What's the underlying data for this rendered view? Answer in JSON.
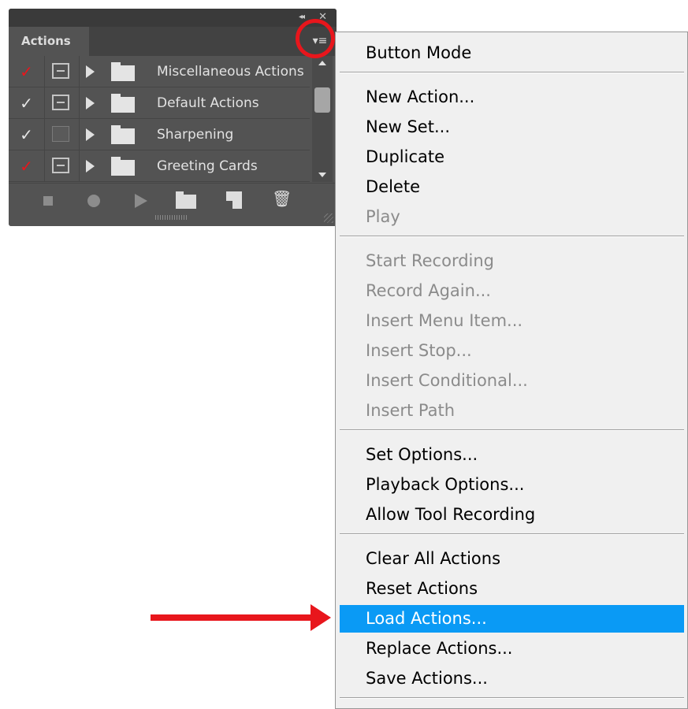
{
  "panel": {
    "tab_label": "Actions",
    "collapse_glyph": "◂◂",
    "close_glyph": "✕",
    "menu_glyph": "▾≡",
    "rows": [
      {
        "label": "Miscellaneous Actions",
        "check": "✓",
        "check_color": "#e8161c",
        "dialog": "on"
      },
      {
        "label": "Default Actions",
        "check": "✓",
        "check_color": "#e6e6e6",
        "dialog": "on"
      },
      {
        "label": "Sharpening",
        "check": "✓",
        "check_color": "#e6e6e6",
        "dialog": "off"
      },
      {
        "label": "Greeting Cards",
        "check": "✓",
        "check_color": "#e8161c",
        "dialog": "on"
      }
    ],
    "toolbar_icons": [
      "stop-icon",
      "record-icon",
      "play-icon",
      "new-set-icon",
      "new-action-icon",
      "trash-icon"
    ],
    "trash_glyph": "🗑"
  },
  "menu": {
    "items": [
      {
        "label": "Button Mode",
        "state": "enabled"
      },
      {
        "label": "New Action...",
        "state": "enabled"
      },
      {
        "label": "New Set...",
        "state": "enabled"
      },
      {
        "label": "Duplicate",
        "state": "enabled"
      },
      {
        "label": "Delete",
        "state": "enabled"
      },
      {
        "label": "Play",
        "state": "disabled"
      },
      {
        "label": "Start Recording",
        "state": "disabled"
      },
      {
        "label": "Record Again...",
        "state": "disabled"
      },
      {
        "label": "Insert Menu Item...",
        "state": "disabled"
      },
      {
        "label": "Insert Stop...",
        "state": "disabled"
      },
      {
        "label": "Insert Conditional...",
        "state": "disabled"
      },
      {
        "label": "Insert Path",
        "state": "disabled"
      },
      {
        "label": "Set Options...",
        "state": "enabled"
      },
      {
        "label": "Playback Options...",
        "state": "enabled"
      },
      {
        "label": "Allow Tool Recording",
        "state": "enabled"
      },
      {
        "label": "Clear All Actions",
        "state": "enabled"
      },
      {
        "label": "Reset Actions",
        "state": "enabled"
      },
      {
        "label": "Load Actions...",
        "state": "selected"
      },
      {
        "label": "Replace Actions...",
        "state": "enabled"
      },
      {
        "label": "Save Actions...",
        "state": "enabled"
      }
    ]
  },
  "colors": {
    "highlight": "#0a9af5",
    "annotation_red": "#e8161c"
  }
}
